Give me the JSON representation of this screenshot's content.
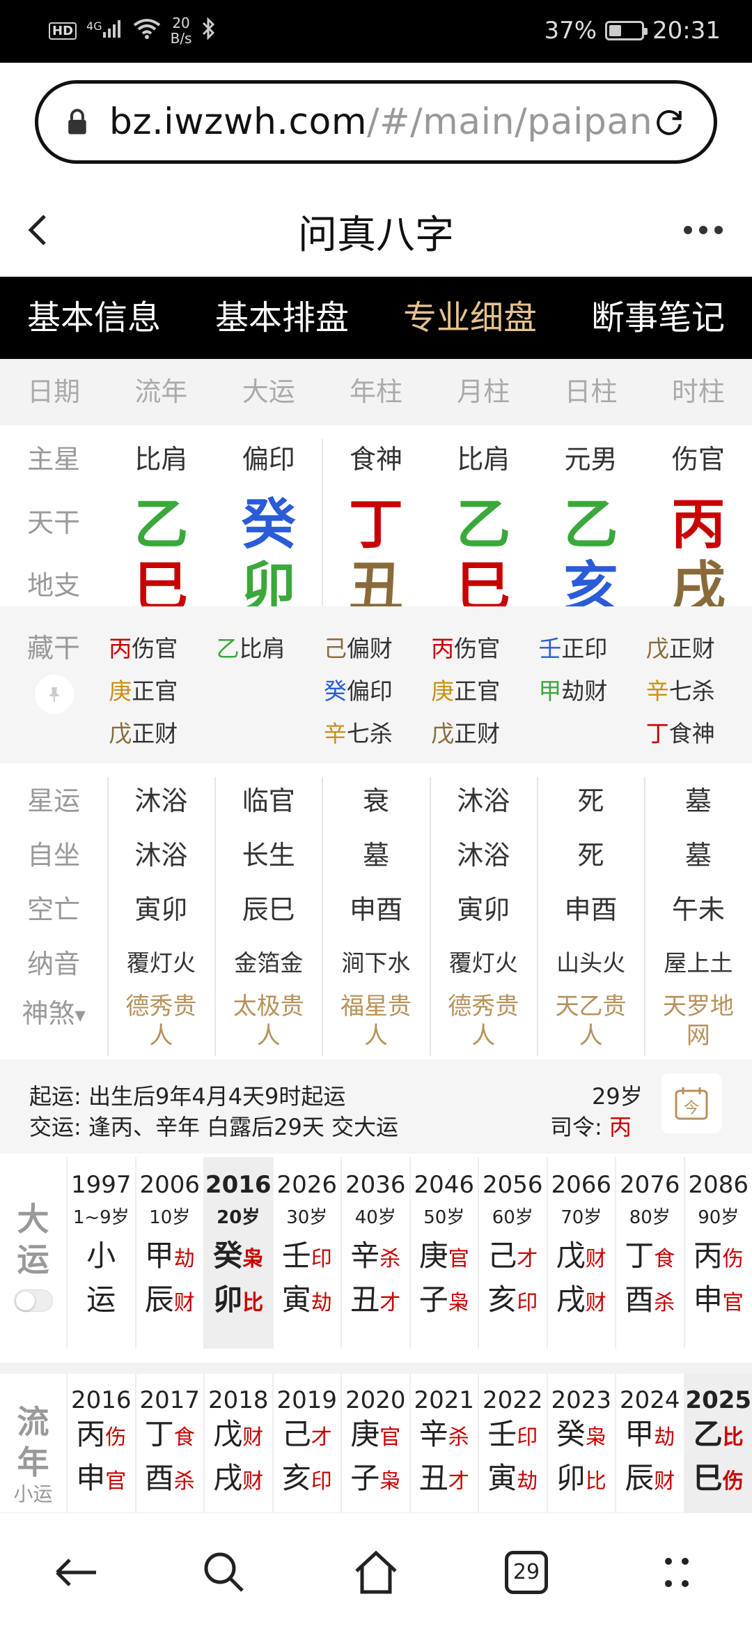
{
  "status_bar": {
    "network": "4G",
    "hd": "HD",
    "speed_value": "20",
    "speed_unit": "B/s",
    "battery": "37%",
    "battery_level": 0.37,
    "time": "20:31"
  },
  "browser": {
    "url_host": "bz.iwzwh.com",
    "url_path": "/#/main/paipan",
    "tab_count": "29"
  },
  "app": {
    "title": "问真八字"
  },
  "tabs": [
    "基本信息",
    "基本排盘",
    "专业细盘",
    "断事笔记"
  ],
  "active_tab": 2,
  "columns": [
    "日期",
    "流年",
    "大运",
    "年柱",
    "月柱",
    "日柱",
    "时柱"
  ],
  "rows": {
    "main_star": {
      "label": "主星",
      "values": [
        "比肩",
        "偏印",
        "食神",
        "比肩",
        "元男",
        "伤官"
      ]
    },
    "tiangan": {
      "label": "天干",
      "values": [
        "乙",
        "癸",
        "丁",
        "乙",
        "乙",
        "丙"
      ],
      "colors": [
        "#3aa83a",
        "#2a5bd8",
        "#c80000",
        "#3aa83a",
        "#3aa83a",
        "#c80000"
      ]
    },
    "dizhi": {
      "label": "地支",
      "values": [
        "巳",
        "卯",
        "丑",
        "巳",
        "亥",
        "戌"
      ],
      "colors": [
        "#c80000",
        "#3aa83a",
        "#8a6a3a",
        "#c80000",
        "#2a5bd8",
        "#8a6a3a"
      ]
    }
  },
  "canggan": {
    "label": "藏干",
    "columns": [
      [
        {
          "g": "丙",
          "c": "#c80000",
          "s": "伤官"
        },
        {
          "g": "庚",
          "c": "#c8901a",
          "s": "正官"
        },
        {
          "g": "戊",
          "c": "#8a6a3a",
          "s": "正财"
        }
      ],
      [
        {
          "g": "乙",
          "c": "#3aa83a",
          "s": "比肩"
        }
      ],
      [
        {
          "g": "己",
          "c": "#8a6a3a",
          "s": "偏财"
        },
        {
          "g": "癸",
          "c": "#2a5bd8",
          "s": "偏印"
        },
        {
          "g": "辛",
          "c": "#c8901a",
          "s": "七杀"
        }
      ],
      [
        {
          "g": "丙",
          "c": "#c80000",
          "s": "伤官"
        },
        {
          "g": "庚",
          "c": "#c8901a",
          "s": "正官"
        },
        {
          "g": "戊",
          "c": "#8a6a3a",
          "s": "正财"
        }
      ],
      [
        {
          "g": "壬",
          "c": "#2a5bd8",
          "s": "正印"
        },
        {
          "g": "甲",
          "c": "#3aa83a",
          "s": "劫财"
        }
      ],
      [
        {
          "g": "戊",
          "c": "#8a6a3a",
          "s": "正财"
        },
        {
          "g": "辛",
          "c": "#c8901a",
          "s": "七杀"
        },
        {
          "g": "丁",
          "c": "#c80000",
          "s": "食神"
        }
      ]
    ]
  },
  "detail": {
    "xingyun": {
      "label": "星运",
      "values": [
        "沐浴",
        "临官",
        "衰",
        "沐浴",
        "死",
        "墓"
      ]
    },
    "zizuo": {
      "label": "自坐",
      "values": [
        "沐浴",
        "长生",
        "墓",
        "沐浴",
        "死",
        "墓"
      ]
    },
    "kongwang": {
      "label": "空亡",
      "values": [
        "寅卯",
        "辰巳",
        "申酉",
        "寅卯",
        "申酉",
        "午未"
      ]
    },
    "nayin": {
      "label": "纳音",
      "values": [
        "覆灯火",
        "金箔金",
        "涧下水",
        "覆灯火",
        "山头火",
        "屋上土"
      ]
    },
    "shensha": {
      "label": "神煞",
      "values": [
        [
          "德秀贵",
          "人"
        ],
        [
          "太极贵",
          "人"
        ],
        [
          "福星贵",
          "人"
        ],
        [
          "德秀贵",
          "人"
        ],
        [
          "天乙贵",
          "人"
        ],
        [
          "天罗地",
          "网"
        ]
      ]
    }
  },
  "qiyun": {
    "qiyun_label": "起运:",
    "qiyun_text": "出生后9年4月4天9时起运",
    "jiaoyun_label": "交运:",
    "jiaoyun_text": "逢丙、辛年 白露后29天 交大运",
    "age": "29岁",
    "siling_label": "司令:",
    "siling_value": "丙"
  },
  "dayun": {
    "label": [
      "大",
      "运"
    ],
    "selected": 2,
    "items": [
      {
        "year": "1997",
        "age": "1~9岁",
        "gan": "小",
        "gs": "",
        "zhi": "运",
        "zs": ""
      },
      {
        "year": "2006",
        "age": "10岁",
        "gan": "甲",
        "gs": "劫",
        "zhi": "辰",
        "zs": "财"
      },
      {
        "year": "2016",
        "age": "20岁",
        "gan": "癸",
        "gs": "枭",
        "zhi": "卯",
        "zs": "比"
      },
      {
        "year": "2026",
        "age": "30岁",
        "gan": "壬",
        "gs": "印",
        "zhi": "寅",
        "zs": "劫"
      },
      {
        "year": "2036",
        "age": "40岁",
        "gan": "辛",
        "gs": "杀",
        "zhi": "丑",
        "zs": "才"
      },
      {
        "year": "2046",
        "age": "50岁",
        "gan": "庚",
        "gs": "官",
        "zhi": "子",
        "zs": "枭"
      },
      {
        "year": "2056",
        "age": "60岁",
        "gan": "己",
        "gs": "才",
        "zhi": "亥",
        "zs": "印"
      },
      {
        "year": "2066",
        "age": "70岁",
        "gan": "戊",
        "gs": "财",
        "zhi": "戌",
        "zs": "财"
      },
      {
        "year": "2076",
        "age": "80岁",
        "gan": "丁",
        "gs": "食",
        "zhi": "酉",
        "zs": "杀"
      },
      {
        "year": "2086",
        "age": "90岁",
        "gan": "丙",
        "gs": "伤",
        "zhi": "申",
        "zs": "官"
      }
    ]
  },
  "liunian": {
    "label": [
      "流",
      "年",
      "小运"
    ],
    "selected": 9,
    "items": [
      {
        "year": "2016",
        "gan": "丙",
        "gs": "伤",
        "zhi": "申",
        "zs": "官"
      },
      {
        "year": "2017",
        "gan": "丁",
        "gs": "食",
        "zhi": "酉",
        "zs": "杀"
      },
      {
        "year": "2018",
        "gan": "戊",
        "gs": "财",
        "zhi": "戌",
        "zs": "财"
      },
      {
        "year": "2019",
        "gan": "己",
        "gs": "才",
        "zhi": "亥",
        "zs": "印"
      },
      {
        "year": "2020",
        "gan": "庚",
        "gs": "官",
        "zhi": "子",
        "zs": "枭"
      },
      {
        "year": "2021",
        "gan": "辛",
        "gs": "杀",
        "zhi": "丑",
        "zs": "才"
      },
      {
        "year": "2022",
        "gan": "壬",
        "gs": "印",
        "zhi": "寅",
        "zs": "劫"
      },
      {
        "year": "2023",
        "gan": "癸",
        "gs": "枭",
        "zhi": "卯",
        "zs": "比"
      },
      {
        "year": "2024",
        "gan": "甲",
        "gs": "劫",
        "zhi": "辰",
        "zs": "财"
      },
      {
        "year": "2025",
        "gan": "乙",
        "gs": "比",
        "zhi": "巳",
        "zs": "伤"
      }
    ]
  }
}
